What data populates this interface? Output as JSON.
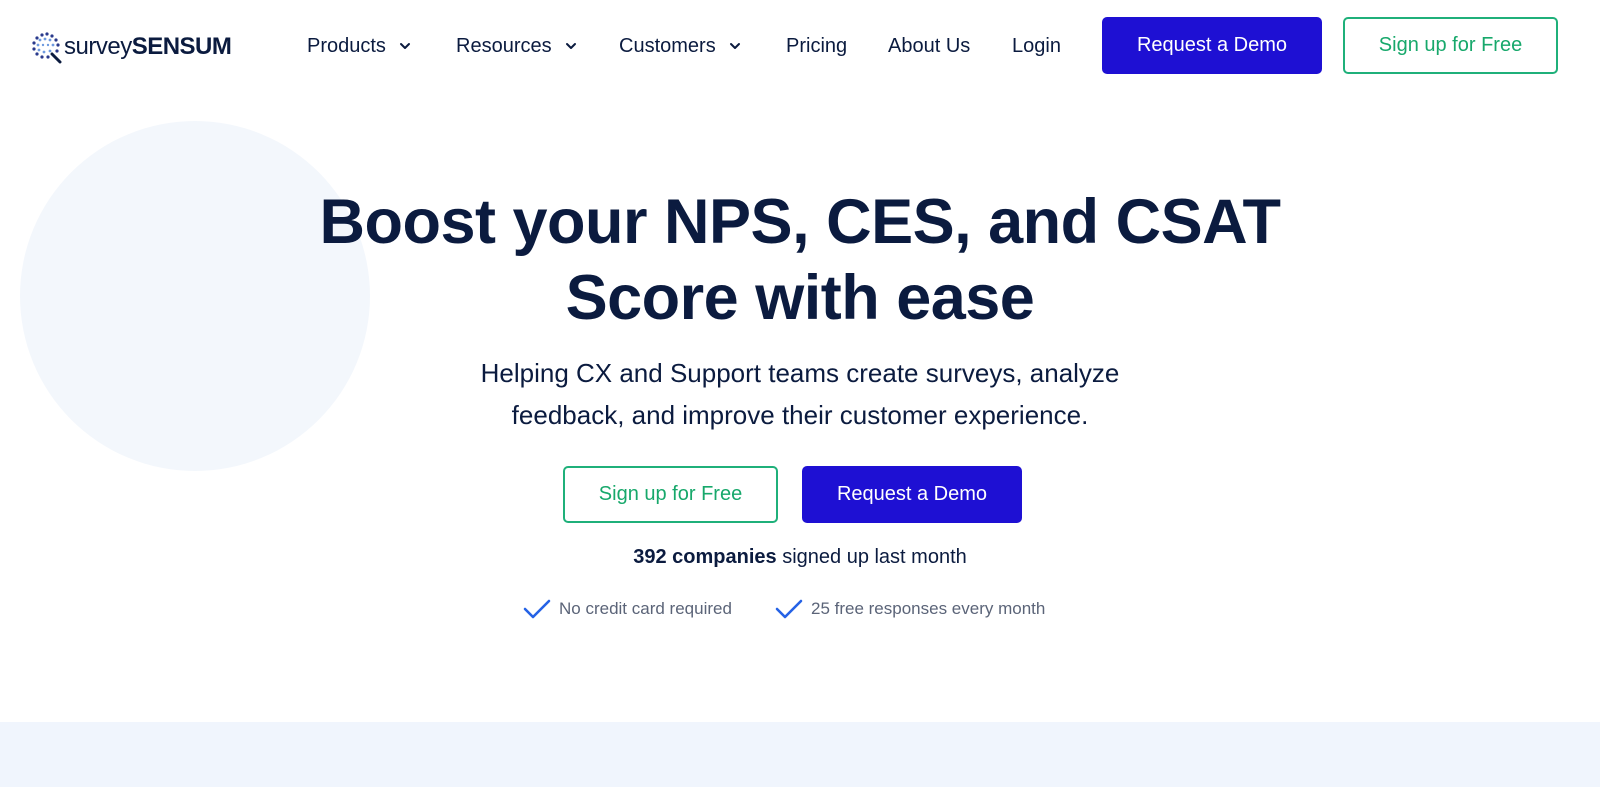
{
  "brand": {
    "logo_word_1": "survey",
    "logo_word_2": "SENSUM",
    "accent": "#1e10d3",
    "secondary": "#1fb07a",
    "text": "#0b1b3f"
  },
  "nav": {
    "items": [
      {
        "label": "Products",
        "icon": "chevron-down-icon"
      },
      {
        "label": "Resources",
        "icon": "chevron-down-icon"
      },
      {
        "label": "Customers",
        "icon": "chevron-down-icon"
      },
      {
        "label": "Pricing"
      },
      {
        "label": "About Us"
      },
      {
        "label": "Login"
      }
    ],
    "demo_button": "Request a Demo",
    "signup_button": "Sign up for Free"
  },
  "hero": {
    "title_line_1": "Boost your NPS, CES, and CSAT",
    "title_line_2": "Score with ease",
    "subtitle_line_1": "Helping CX and Support teams create surveys, analyze",
    "subtitle_line_2": "feedback, and improve their customer experience.",
    "signup_button": "Sign up for Free",
    "demo_button": "Request a Demo",
    "social_proof_bold": "392 companies",
    "social_proof_rest": " signed up last month",
    "features": [
      {
        "icon": "checkmark-icon",
        "label": "No credit card required"
      },
      {
        "icon": "checkmark-icon",
        "label": "25 free responses every month"
      }
    ]
  }
}
